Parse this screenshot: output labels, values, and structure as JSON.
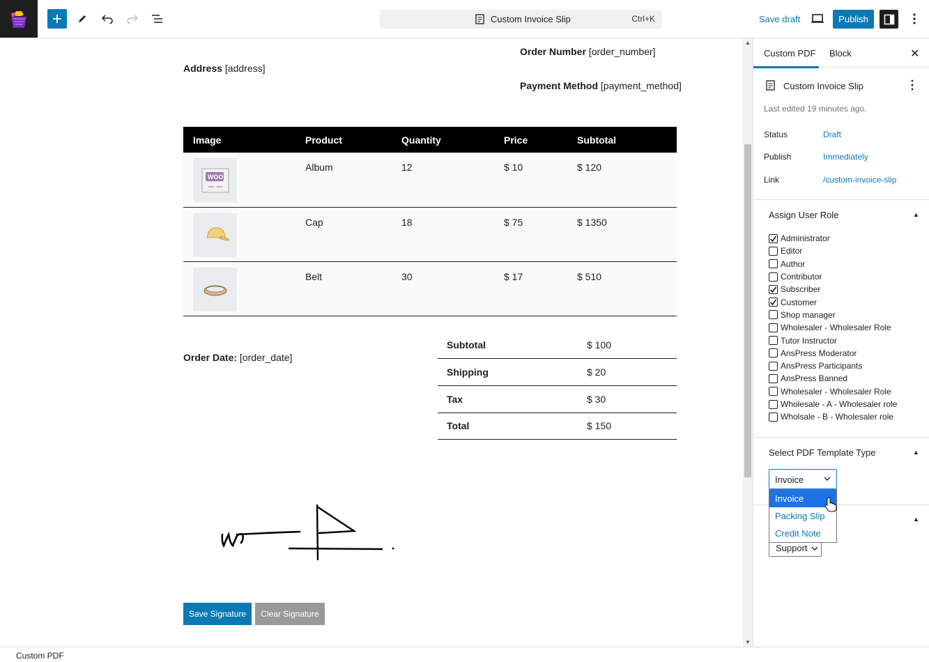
{
  "topbar": {
    "doc_title": "Custom Invoice Slip",
    "shortcut": "Ctrl+K",
    "save_draft": "Save draft",
    "publish": "Publish"
  },
  "document": {
    "order_number_label": "Order Number",
    "order_number_value": "[order_number]",
    "address_label": "Address",
    "address_value": "[address]",
    "payment_method_label": "Payment Method",
    "payment_method_value": "[payment_method]",
    "order_date_label": "Order Date:",
    "order_date_value": "[order_date]",
    "items_table": {
      "headers": [
        "Image",
        "Product",
        "Quantity",
        "Price",
        "Subtotal"
      ],
      "rows": [
        {
          "product": "Album",
          "quantity": "12",
          "price": "$ 10",
          "subtotal": "$ 120",
          "image": "woo-album-icon"
        },
        {
          "product": "Cap",
          "quantity": "18",
          "price": "$ 75",
          "subtotal": "$ 1350",
          "image": "cap-icon"
        },
        {
          "product": "Belt",
          "quantity": "30",
          "price": "$ 17",
          "subtotal": "$ 510",
          "image": "belt-icon"
        }
      ]
    },
    "totals": [
      {
        "label": "Subtotal",
        "value": "$ 100"
      },
      {
        "label": "Shipping",
        "value": "$ 20"
      },
      {
        "label": "Tax",
        "value": "$ 30"
      },
      {
        "label": "Total",
        "value": "$ 150"
      }
    ],
    "save_signature": "Save Signature",
    "clear_signature": "Clear Signature"
  },
  "sidebar": {
    "tabs": [
      "Custom PDF",
      "Block"
    ],
    "post_title": "Custom Invoice Slip",
    "last_edited": "Last edited 19 minutes ago.",
    "meta": [
      {
        "key": "Status",
        "value": "Draft"
      },
      {
        "key": "Publish",
        "value": "Immediately"
      },
      {
        "key": "Link",
        "value": "/custom-invoice-slip"
      }
    ],
    "assign_role_title": "Assign User Role",
    "roles": [
      {
        "label": "Administrator",
        "checked": true
      },
      {
        "label": "Editor",
        "checked": false
      },
      {
        "label": "Author",
        "checked": false
      },
      {
        "label": "Contributor",
        "checked": false
      },
      {
        "label": "Subscriber",
        "checked": true
      },
      {
        "label": "Customer",
        "checked": true
      },
      {
        "label": "Shop manager",
        "checked": false
      },
      {
        "label": "Wholesaler - Wholesaler Role",
        "checked": false
      },
      {
        "label": "Tutor Instructor",
        "checked": false
      },
      {
        "label": "AnsPress Moderator",
        "checked": false
      },
      {
        "label": "AnsPress Participants",
        "checked": false
      },
      {
        "label": "AnsPress Banned",
        "checked": false
      },
      {
        "label": "Wholesaler - Wholesaler Role",
        "checked": false
      },
      {
        "label": "Wholesale - A - Wholesaler role",
        "checked": false
      },
      {
        "label": "Wholsale - B - Wholesaler role",
        "checked": false
      }
    ],
    "template_type_title": "Select PDF Template Type",
    "template_selected": "Invoice",
    "template_options": [
      "Invoice",
      "Packing Slip",
      "Credit Note"
    ],
    "support_value": "Support"
  },
  "statusbar": {
    "text": "Custom PDF"
  }
}
